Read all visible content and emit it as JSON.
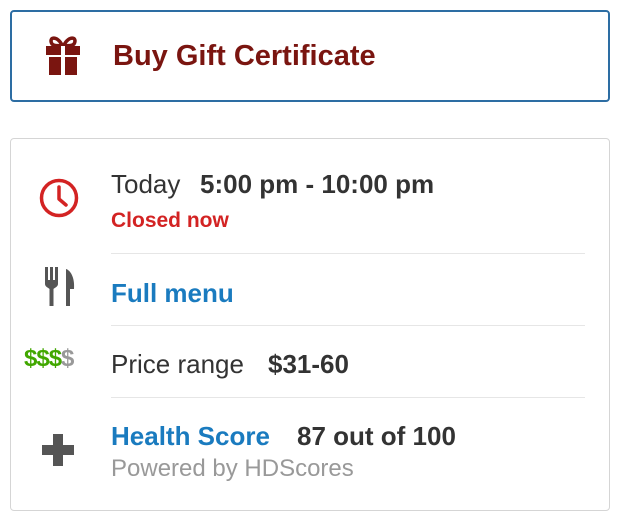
{
  "gift": {
    "label": "Buy Gift Certificate",
    "icon": "gift-icon",
    "color": "#7a1510",
    "border_color": "#2d6da3"
  },
  "hours": {
    "icon": "clock-icon",
    "day_label": "Today",
    "time_range": "5:00 pm - 10:00 pm",
    "status": "Closed now",
    "status_color": "#d32323"
  },
  "menu": {
    "icon": "fork-knife-icon",
    "link_label": "Full menu",
    "link_color": "#1a7bbf"
  },
  "price": {
    "icon_active": "$$$",
    "icon_inactive": "$",
    "label": "Price range",
    "value": "$31-60",
    "active_color": "#41a700"
  },
  "health": {
    "icon": "plus-icon",
    "link_label": "Health Score",
    "score": "87 out of 100",
    "source": "Powered by HDScores"
  }
}
